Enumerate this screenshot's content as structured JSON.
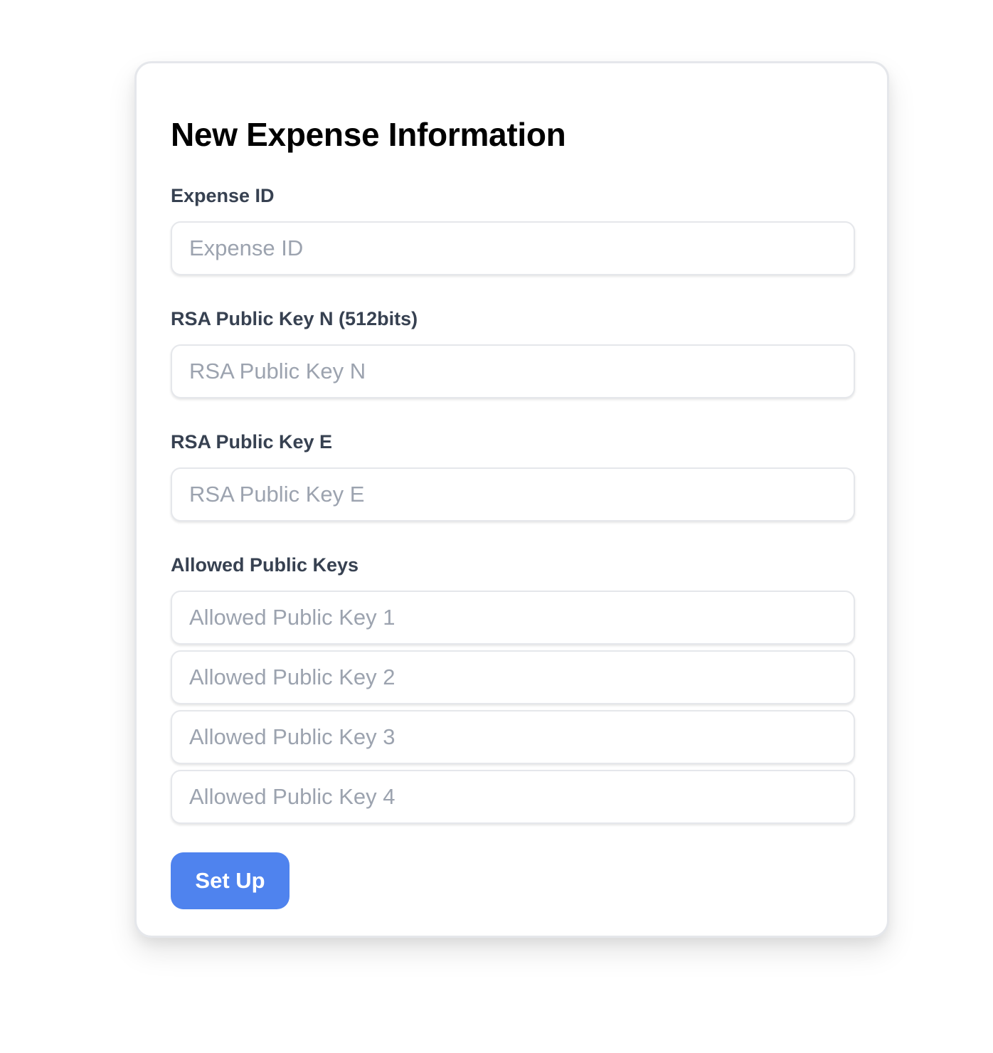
{
  "form": {
    "title": "New Expense Information",
    "expense_id": {
      "label": "Expense ID",
      "placeholder": "Expense ID",
      "value": ""
    },
    "rsa_n": {
      "label": "RSA Public Key N (512bits)",
      "placeholder": "RSA Public Key N",
      "value": ""
    },
    "rsa_e": {
      "label": "RSA Public Key E",
      "placeholder": "RSA Public Key E",
      "value": ""
    },
    "allowed_keys": {
      "label": "Allowed Public Keys",
      "inputs": [
        {
          "placeholder": "Allowed Public Key 1",
          "value": ""
        },
        {
          "placeholder": "Allowed Public Key 2",
          "value": ""
        },
        {
          "placeholder": "Allowed Public Key 3",
          "value": ""
        },
        {
          "placeholder": "Allowed Public Key 4",
          "value": ""
        }
      ]
    },
    "submit_label": "Set Up"
  },
  "colors": {
    "button": "#4f83ee",
    "label": "#374151",
    "placeholder": "#9ca3af",
    "border": "#e5e7eb"
  }
}
